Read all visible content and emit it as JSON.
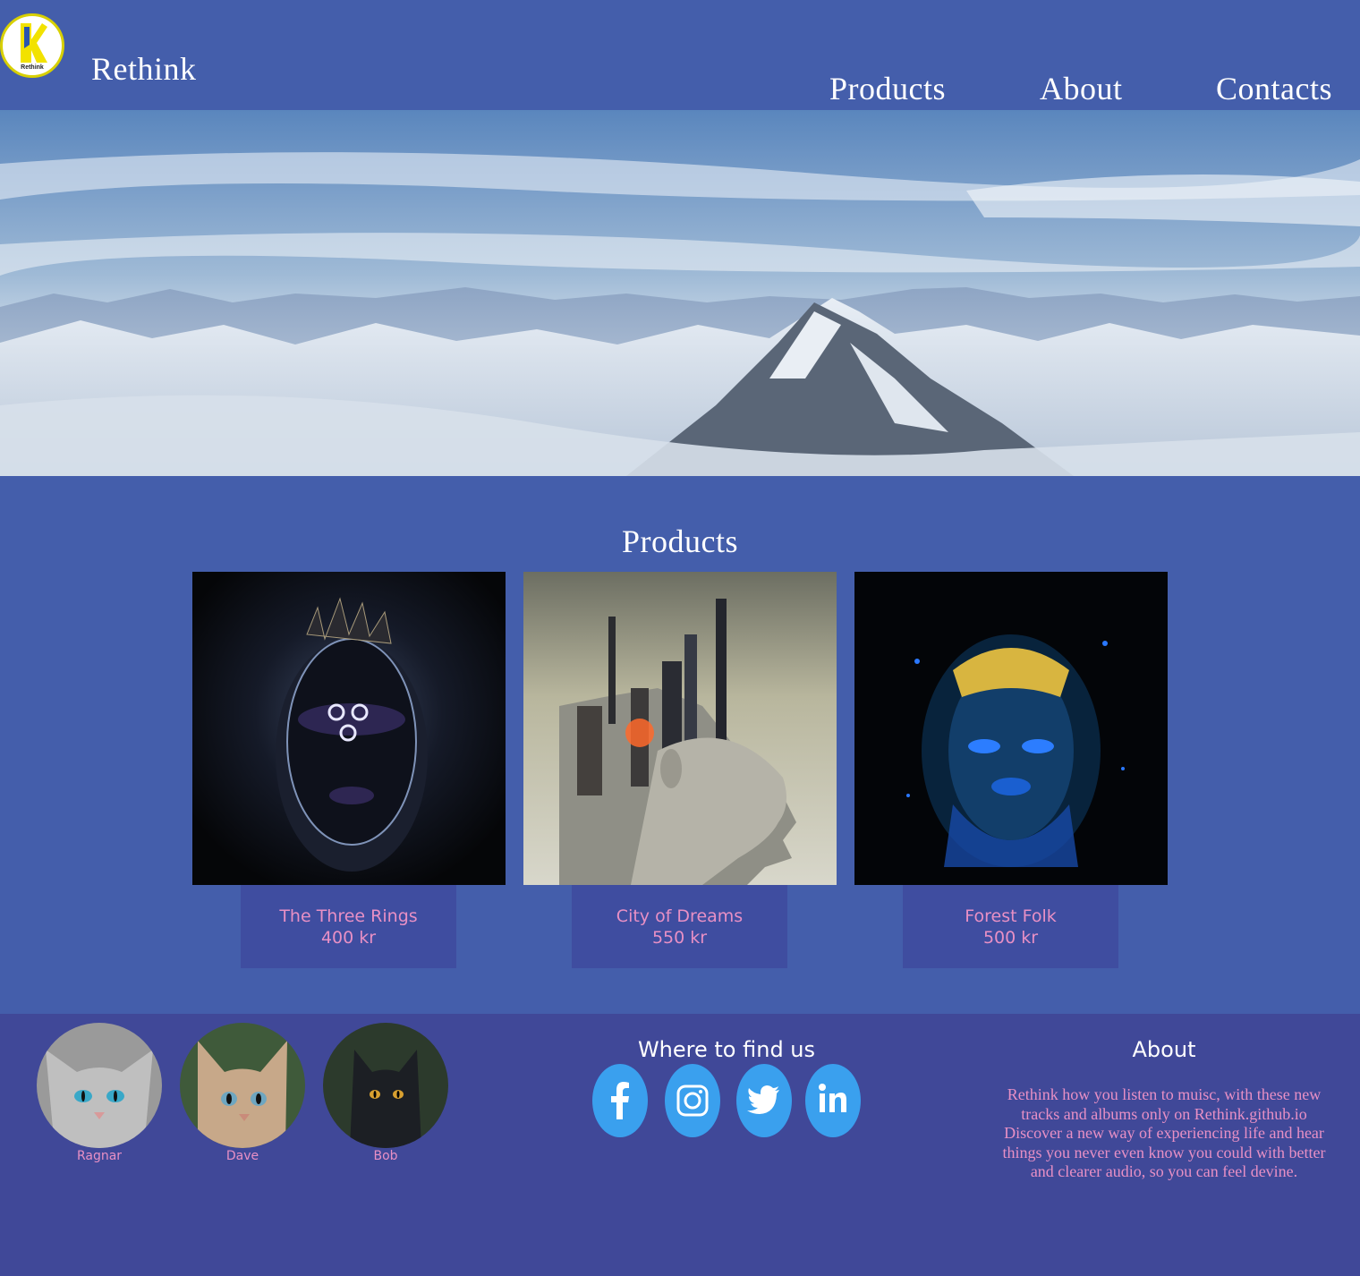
{
  "header": {
    "logo_text": "Rethink",
    "brand": "Rethink",
    "nav": [
      {
        "label": "Products"
      },
      {
        "label": "About"
      },
      {
        "label": "Contacts"
      }
    ]
  },
  "products": {
    "title": "Products",
    "items": [
      {
        "name": "The Three Rings",
        "price": "400 kr"
      },
      {
        "name": "City of Dreams",
        "price": "550 kr"
      },
      {
        "name": "Forest Folk",
        "price": "500 kr"
      }
    ]
  },
  "footer": {
    "team": [
      {
        "name": "Ragnar"
      },
      {
        "name": "Dave"
      },
      {
        "name": "Bob"
      }
    ],
    "find_title": "Where to find us",
    "social": [
      "facebook-icon",
      "instagram-icon",
      "twitter-icon",
      "linkedin-icon"
    ],
    "about_title": "About",
    "about_text": "Rethink how you listen to muisc, with these new tracks and albums only on Rethink.github.io Discover a new way of experiencing life and hear things you never even know you could with better and clearer audio, so you can feel devine."
  },
  "colors": {
    "background": "#445eab",
    "footer": "#404898",
    "card_info": "#3f4da0",
    "accent_pink": "#e890c5",
    "social_blue": "#3aa0ee"
  }
}
